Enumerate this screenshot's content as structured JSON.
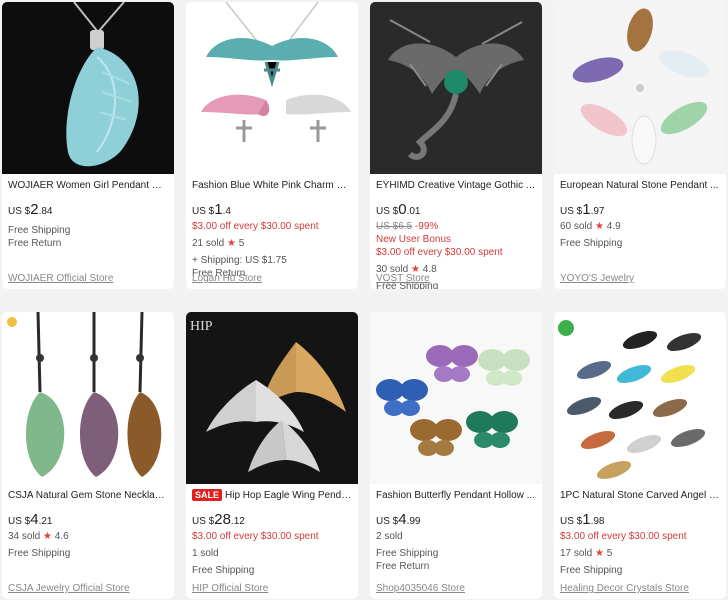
{
  "products": [
    {
      "title": "WOJIAER Women Girl Pendant & N...",
      "price": {
        "currency": "US $",
        "int": "2",
        "dec": ".84"
      },
      "lines": [
        "Free Shipping",
        "Free Return"
      ],
      "store": "WOJIAER Official Store",
      "image_icon": "crystal-wing-pendant-icon"
    },
    {
      "title": "Fashion Blue White Pink Charm Cr...",
      "price": {
        "currency": "US $",
        "int": "1",
        "dec": ".4"
      },
      "promo": "$3.00 off every $30.00 spent",
      "sold": "21 sold",
      "rating": "5",
      "lines": [
        "+ Shipping: US $1.75",
        "Free Return"
      ],
      "store": "Logan Hu Store",
      "image_icon": "angel-wings-necklace-icon"
    },
    {
      "title": "EYHIMD Creative Vintage Gothic A...",
      "price": {
        "currency": "US $",
        "int": "0",
        "dec": ".01"
      },
      "original_price": "US $6.5",
      "discount": "-99%",
      "bonus": "New User Bonus",
      "promo": "$3.00 off every $30.00 spent",
      "sold": "30 sold",
      "rating": "4.8",
      "lines": [
        "Free Shipping"
      ],
      "store": "VOST Store",
      "image_icon": "gothic-dragon-pendant-icon"
    },
    {
      "title": "European Natural Stone Pendant ...",
      "price": {
        "currency": "US $",
        "int": "1",
        "dec": ".97"
      },
      "sold": "60 sold",
      "rating": "4.9",
      "lines": [
        "Free Shipping"
      ],
      "store": "YOYO'S Jewelry",
      "image_icon": "stone-wing-pendants-icon"
    },
    {
      "title": "CSJA Natural Gem Stone Necklace ...",
      "price": {
        "currency": "US $",
        "int": "4",
        "dec": ".21"
      },
      "sold": "34 sold",
      "rating": "4.6",
      "lines": [
        "Free Shipping"
      ],
      "store": "CSJA Jewelry Official Store",
      "image_icon": "gem-wing-necklaces-icon"
    },
    {
      "badge": "SALE",
      "title": "Hip Hop Eagle Wing Penda...",
      "price": {
        "currency": "US $",
        "int": "28",
        "dec": ".12"
      },
      "promo": "$3.00 off every $30.00 spent",
      "sold": "1 sold",
      "lines": [
        "Free Shipping"
      ],
      "store": "HIP Official Store",
      "image_icon": "eagle-wing-pendant-icon",
      "image_label": "HIP"
    },
    {
      "title": "Fashion Butterfly Pendant Hollow ...",
      "price": {
        "currency": "US $",
        "int": "4",
        "dec": ".99"
      },
      "sold": "2 sold",
      "lines": [
        "Free Shipping",
        "Free Return"
      ],
      "store": "Shop4035046 Store",
      "image_icon": "butterfly-pendants-icon"
    },
    {
      "title": "1PC Natural Stone Carved Angel W...",
      "price": {
        "currency": "US $",
        "int": "1",
        "dec": ".98"
      },
      "promo": "$3.00 off every $30.00 spent",
      "sold": "17 sold",
      "rating": "5",
      "lines": [
        "Free Shipping"
      ],
      "store": "Healing Decor Crystals Store",
      "image_icon": "carved-angel-wings-icon"
    }
  ],
  "colors": {
    "accent_red": "#d23b3b",
    "star": "#e0433b",
    "background": "#f2f2f2"
  }
}
